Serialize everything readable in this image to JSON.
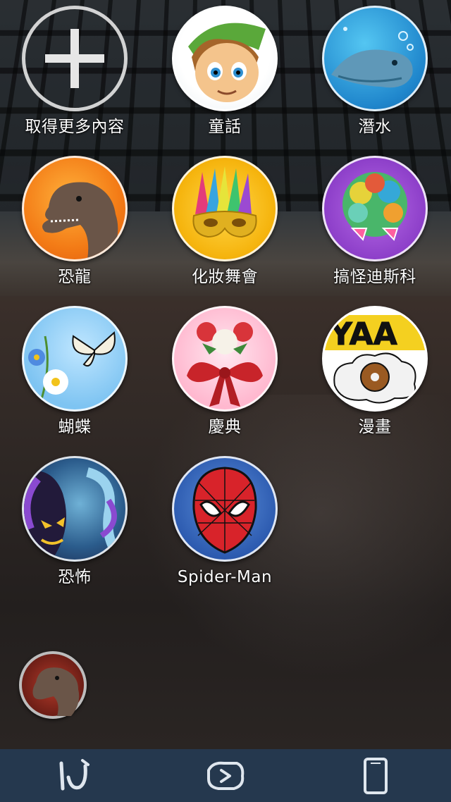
{
  "tiles": [
    {
      "label": "取得更多內容",
      "icon": "add-icon"
    },
    {
      "label": "童話",
      "icon": "fairy-tale-elf-icon"
    },
    {
      "label": "潛水",
      "icon": "diving-fish-icon"
    },
    {
      "label": "恐龍",
      "icon": "dinosaur-icon"
    },
    {
      "label": "化妝舞會",
      "icon": "masquerade-mask-icon"
    },
    {
      "label": "搞怪迪斯科",
      "icon": "disco-afro-icon"
    },
    {
      "label": "蝴蝶",
      "icon": "butterfly-icon"
    },
    {
      "label": "慶典",
      "icon": "celebration-roses-icon"
    },
    {
      "label": "漫畫",
      "icon": "comic-donut-icon"
    },
    {
      "label": "恐怖",
      "icon": "horror-ghost-icon"
    },
    {
      "label": "Spider-Man",
      "icon": "spiderman-mask-icon"
    }
  ],
  "selected_effect_thumbnail": {
    "icon": "dinosaur-thumbnail-icon"
  },
  "bottom_bar": {
    "items": [
      {
        "icon": "effects-icon"
      },
      {
        "icon": "flip-camera-icon"
      },
      {
        "icon": "phone-frame-icon"
      }
    ],
    "background_color": "#25384e"
  }
}
